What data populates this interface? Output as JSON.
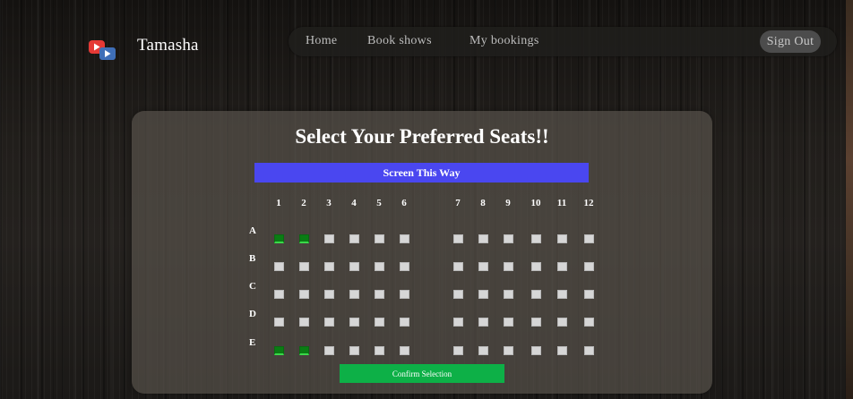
{
  "header": {
    "brand": "Tamasha",
    "logo_icon": "youtube-play-icon",
    "nav": [
      {
        "label": "Home"
      },
      {
        "label": "Book shows"
      },
      {
        "label": "My bookings"
      }
    ],
    "sign_out": "Sign Out"
  },
  "booking": {
    "title": "Select Your Preferred Seats!!",
    "screen_label": "Screen This Way",
    "columns": [
      "1",
      "2",
      "3",
      "4",
      "5",
      "6",
      "7",
      "8",
      "9",
      "10",
      "11",
      "12"
    ],
    "rows": [
      "A",
      "B",
      "C",
      "D",
      "E"
    ],
    "selected_seats": [
      "A1",
      "A2",
      "E1",
      "E2"
    ],
    "confirm_label": "Confirm Selection"
  },
  "colors": {
    "seat_available": "#d6d6d6",
    "seat_selected": "#0a7d14",
    "screen_bar": "#4a47f0",
    "confirm_button": "#0db047"
  }
}
